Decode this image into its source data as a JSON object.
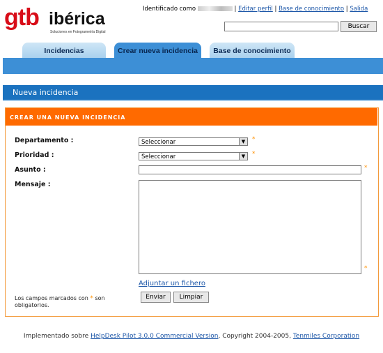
{
  "header": {
    "logo_gtb": "gtb",
    "logo_iberica": "ibérica",
    "logo_tagline": "Soluciones en Fotogrametría Digital",
    "identified_prefix": "Identificado como",
    "edit_profile": "Editar perfil",
    "knowledge_base": "Base de conocimiento",
    "logout": "Salida",
    "search_value": "",
    "search_button": "Buscar"
  },
  "tabs": [
    {
      "label": "Incidencias",
      "active": false
    },
    {
      "label": "Crear nueva incidencia",
      "active": true
    },
    {
      "label": "Base de conocimiento",
      "active": false
    }
  ],
  "section": {
    "title": "Nueva incidencia"
  },
  "form": {
    "heading": "CREAR UNA NUEVA INCIDENCIA",
    "department_label": "Departamento :",
    "department_value": "Seleccionar",
    "priority_label": "Prioridad :",
    "priority_value": "Seleccionar",
    "subject_label": "Asunto :",
    "subject_value": "",
    "message_label": "Mensaje :",
    "message_value": "",
    "attach_link": "Adjuntar un fichero",
    "submit_button": "Enviar",
    "clear_button": "Limpiar",
    "required_star": "*",
    "note_before": "Los campos marcados con",
    "note_after": "son obligatorios."
  },
  "footer": {
    "prefix": "Implementado sobre",
    "product_link": "HelpDesk Pilot 3.0.0 Commercial Version",
    "middle": ", Copyright 2004-2005,",
    "company_link": "Tenmiles Corporation"
  },
  "colors": {
    "brand_red": "#d80c18",
    "tab_active": "#3d8fd6",
    "section_blue": "#1b72bf",
    "panel_orange": "#ff6a00",
    "link_blue": "#1d57a8"
  }
}
